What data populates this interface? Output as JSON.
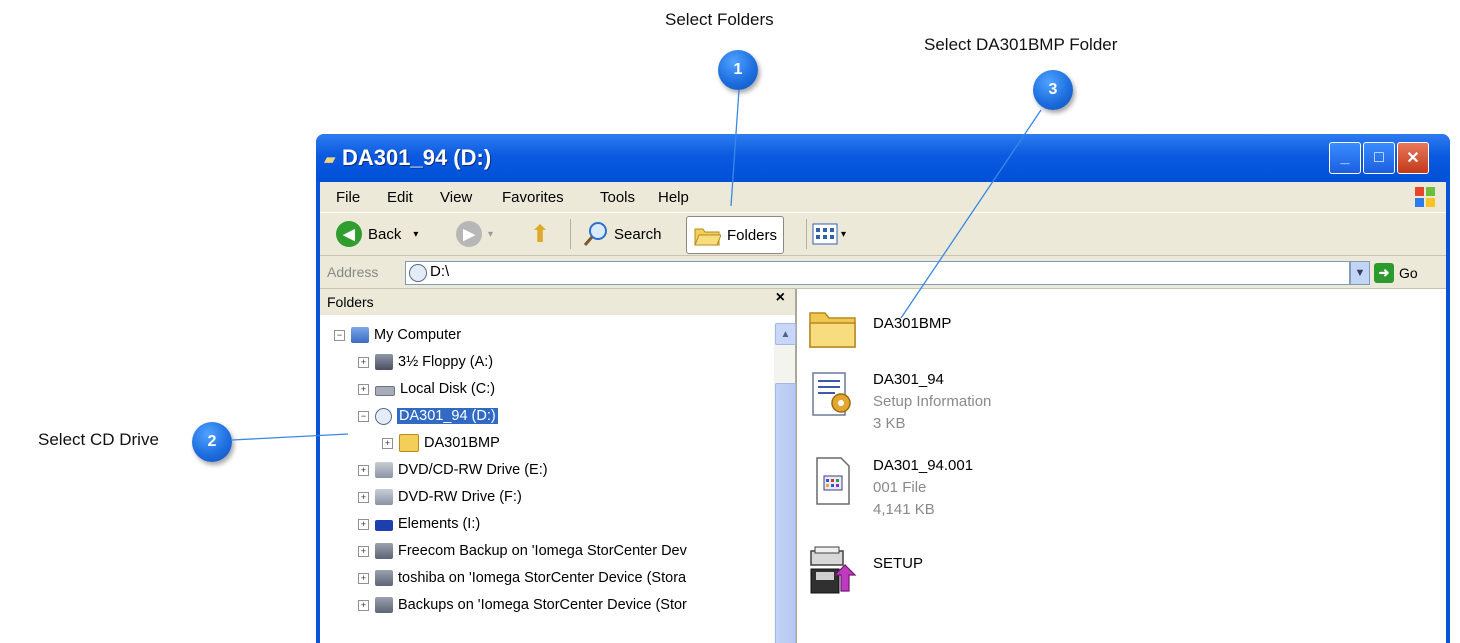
{
  "callouts": [
    {
      "number": "1",
      "label": "Select Folders"
    },
    {
      "number": "2",
      "label": "Select CD Drive"
    },
    {
      "number": "3",
      "label": "Select DA301BMP Folder"
    }
  ],
  "window": {
    "title": "DA301_94 (D:)",
    "controls": {
      "minimize": "_",
      "maximize": "□",
      "close": "✕"
    }
  },
  "menu": [
    "File",
    "Edit",
    "View",
    "Favorites",
    "Tools",
    "Help"
  ],
  "toolbar": {
    "back": "Back",
    "search": "Search",
    "folders": "Folders"
  },
  "address": {
    "label": "Address",
    "value": "D:\\",
    "go": "Go"
  },
  "folders_pane": {
    "title": "Folders",
    "close": "×",
    "tree": [
      {
        "label": "My Computer",
        "expander": "−",
        "icon": "computer-icon",
        "depth": 0
      },
      {
        "label": "3½ Floppy (A:)",
        "expander": "+",
        "icon": "floppy-icon",
        "depth": 1
      },
      {
        "label": "Local Disk (C:)",
        "expander": "+",
        "icon": "hard-disk-icon",
        "depth": 1
      },
      {
        "label": "DA301_94 (D:)",
        "expander": "−",
        "icon": "cd-drive-icon",
        "depth": 1,
        "selected": true
      },
      {
        "label": "DA301BMP",
        "expander": "+",
        "icon": "folder-icon",
        "depth": 2
      },
      {
        "label": "DVD/CD-RW Drive (E:)",
        "expander": "+",
        "icon": "dvd-drive-icon",
        "depth": 1
      },
      {
        "label": "DVD-RW Drive (F:)",
        "expander": "+",
        "icon": "dvd-drive-icon",
        "depth": 1
      },
      {
        "label": "Elements (I:)",
        "expander": "+",
        "icon": "wd-drive-icon",
        "depth": 1
      },
      {
        "label": "Freecom Backup on 'Iomega StorCenter Dev",
        "expander": "+",
        "icon": "network-drive-icon",
        "depth": 1
      },
      {
        "label": "toshiba on 'Iomega StorCenter Device (Stora",
        "expander": "+",
        "icon": "network-drive-icon",
        "depth": 1
      },
      {
        "label": "Backups on 'Iomega StorCenter Device (Stor",
        "expander": "+",
        "icon": "network-drive-icon",
        "depth": 1
      }
    ]
  },
  "files": [
    {
      "name": "DA301BMP",
      "type": "",
      "size": "",
      "icon": "folder-icon"
    },
    {
      "name": "DA301_94",
      "type": "Setup Information",
      "size": "3 KB",
      "icon": "setup-information-icon"
    },
    {
      "name": "DA301_94.001",
      "type": "001 File",
      "size": "4,141 KB",
      "icon": "generic-file-icon"
    },
    {
      "name": "SETUP",
      "type": "",
      "size": "",
      "icon": "setup-program-icon"
    }
  ],
  "colors": {
    "title_bar": "#0b5ae0",
    "selection": "#316ac5",
    "callout_badge": "#1f6fe0",
    "window_face": "#ece9d8"
  }
}
